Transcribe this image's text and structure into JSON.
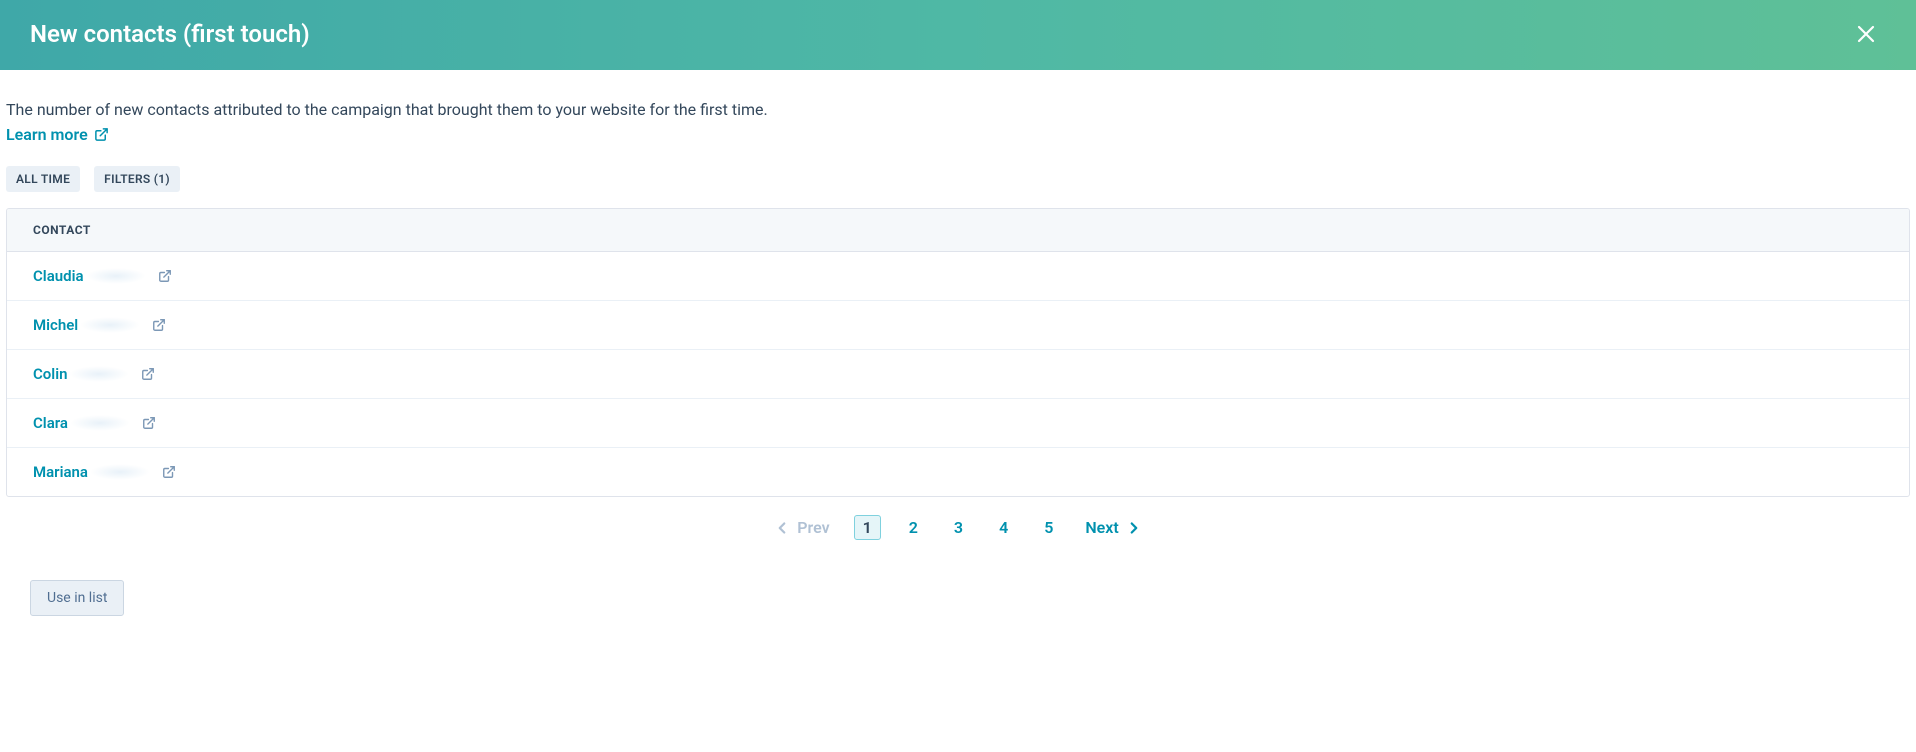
{
  "header": {
    "title": "New contacts (first touch)"
  },
  "description": "The number of new contacts attributed to the campaign that brought them to your website for the first time.",
  "learn_more": "Learn more",
  "tags": {
    "all_time": "ALL TIME",
    "filters": "FILTERS (1)"
  },
  "table": {
    "header": "CONTACT",
    "contacts": [
      {
        "name": "Claudia"
      },
      {
        "name": "Michel"
      },
      {
        "name": "Colin"
      },
      {
        "name": "Clara"
      },
      {
        "name": "Mariana"
      }
    ]
  },
  "pagination": {
    "prev": "Prev",
    "next": "Next",
    "pages": [
      "1",
      "2",
      "3",
      "4",
      "5"
    ],
    "current": 1
  },
  "footer": {
    "use_in_list": "Use in list"
  }
}
